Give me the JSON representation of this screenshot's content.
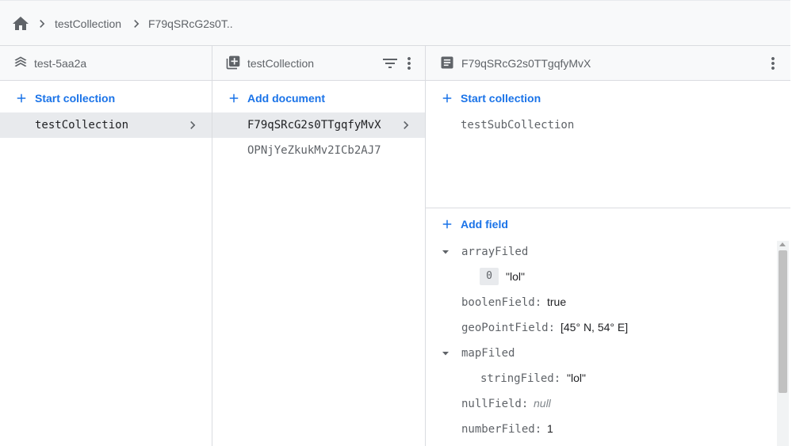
{
  "breadcrumb": {
    "home_icon": "home-icon",
    "items": [
      "testCollection",
      "F79qSRcG2s0T.."
    ]
  },
  "columns": {
    "project": {
      "title": "test-5aa2a",
      "icon": "firebase-stack-icon",
      "action_label": "Start collection",
      "items": [
        {
          "label": "testCollection",
          "selected": true
        }
      ]
    },
    "collection": {
      "title": "testCollection",
      "icon": "collection-icon",
      "action_label": "Add document",
      "items": [
        {
          "label": "F79qSRcG2s0TTgqfyMvX",
          "selected": true
        },
        {
          "label": "OPNjYeZkukMv2ICb2AJ7",
          "selected": false
        }
      ]
    },
    "document": {
      "title": "F79qSRcG2s0TTgqfyMvX",
      "icon": "document-icon",
      "collection_action_label": "Start collection",
      "subcollections": [
        "testSubCollection"
      ],
      "field_action_label": "Add field",
      "fields": {
        "arrayFiled": {
          "key": "arrayFiled",
          "index": "0",
          "value": "\"lol\""
        },
        "boolenField": {
          "key": "boolenField:",
          "value": "true"
        },
        "geoPointField": {
          "key": "geoPointField:",
          "value": "[45° N, 54° E]"
        },
        "mapFiled": {
          "key": "mapFiled",
          "child_key": "stringFiled:",
          "child_value": "\"lol\""
        },
        "nullField": {
          "key": "nullField:",
          "value": "null"
        },
        "numberFiled": {
          "key": "numberFiled:",
          "value": "1"
        }
      }
    }
  },
  "colors": {
    "accent": "#1a73e8",
    "header_bg": "#f8f9fa",
    "selected_bg": "#e8eaed"
  }
}
